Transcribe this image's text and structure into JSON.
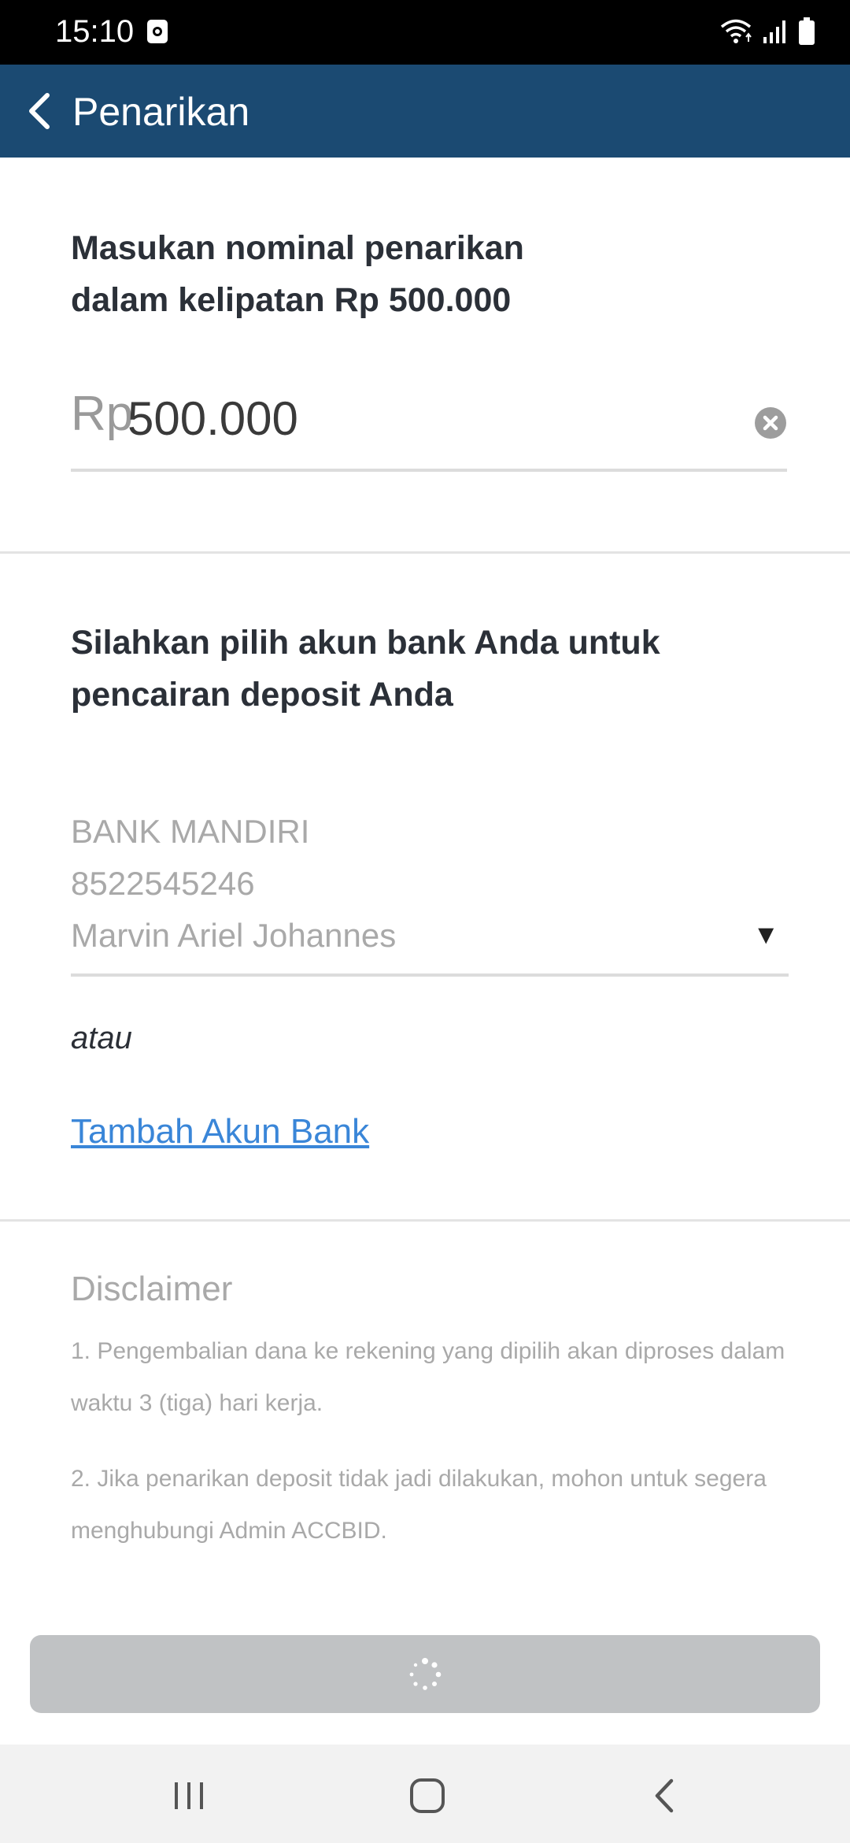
{
  "status_bar": {
    "time": "15:10"
  },
  "header": {
    "title": "Penarikan"
  },
  "amount_section": {
    "heading_line1": "Masukan nominal penarikan",
    "heading_line2": "dalam kelipatan Rp 500.000",
    "prefix": "Rp",
    "value": "500.000"
  },
  "bank_section": {
    "heading_line1": "Silahkan pilih akun bank Anda untuk",
    "heading_line2": "pencairan deposit Anda",
    "bank_name": "BANK MANDIRI",
    "account_number": "8522545246",
    "account_holder": "Marvin Ariel Johannes",
    "arrow": "▼",
    "or_text": "atau",
    "add_bank_label": "Tambah Akun Bank"
  },
  "disclaimer": {
    "title": "Disclaimer",
    "item1_line1": "1. Pengembalian dana ke rekening yang dipilih akan diproses dalam",
    "item1_line2": "waktu 3 (tiga) hari kerja.",
    "item2_line1": "2. Jika penarikan deposit tidak jadi dilakukan, mohon untuk segera",
    "item2_line2": "menghubungi Admin ACCBID."
  },
  "icons": {
    "back": "back-arrow-icon",
    "clear": "clear-circle-icon",
    "spinner": "loading-spinner-icon",
    "nav_recents": "recents-icon",
    "nav_home": "home-icon",
    "nav_back": "nav-back-icon"
  },
  "colors": {
    "app_bar": "#1b4a72",
    "link": "#3a86d8",
    "button_disabled": "#c0c2c4"
  }
}
